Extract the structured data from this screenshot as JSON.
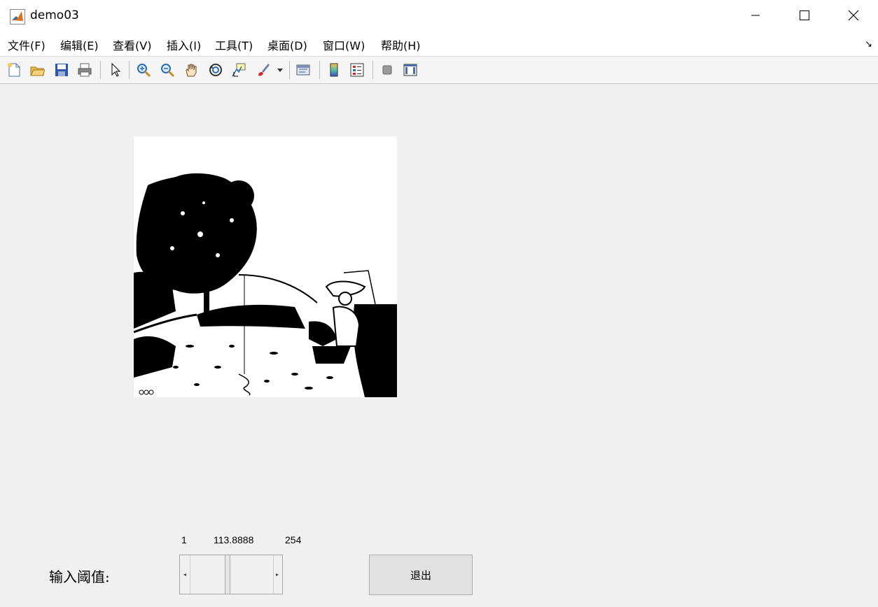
{
  "window": {
    "title": "demo03"
  },
  "menu": [
    "文件(F)",
    "编辑(E)",
    "查看(V)",
    "插入(I)",
    "工具(T)",
    "桌面(D)",
    "窗口(W)",
    "帮助(H)"
  ],
  "toolbar_icons": [
    "new-figure-icon",
    "open-file-icon",
    "save-icon",
    "print-icon",
    "pointer-icon",
    "zoom-in-icon",
    "zoom-out-icon",
    "pan-hand-icon",
    "rotate-3d-icon",
    "data-cursor-icon",
    "brush-icon",
    "brush-dropdown-icon",
    "link-plot-icon",
    "colorbar-icon",
    "legend-icon",
    "hide-plot-tools-icon",
    "show-plot-tools-icon"
  ],
  "controls": {
    "threshold_label": "输入阈值:",
    "slider": {
      "min_label": "1",
      "value_label": "113.8888",
      "max_label": "254",
      "min": 1,
      "max": 254,
      "value": 113.8888
    },
    "exit_label": "退出"
  }
}
